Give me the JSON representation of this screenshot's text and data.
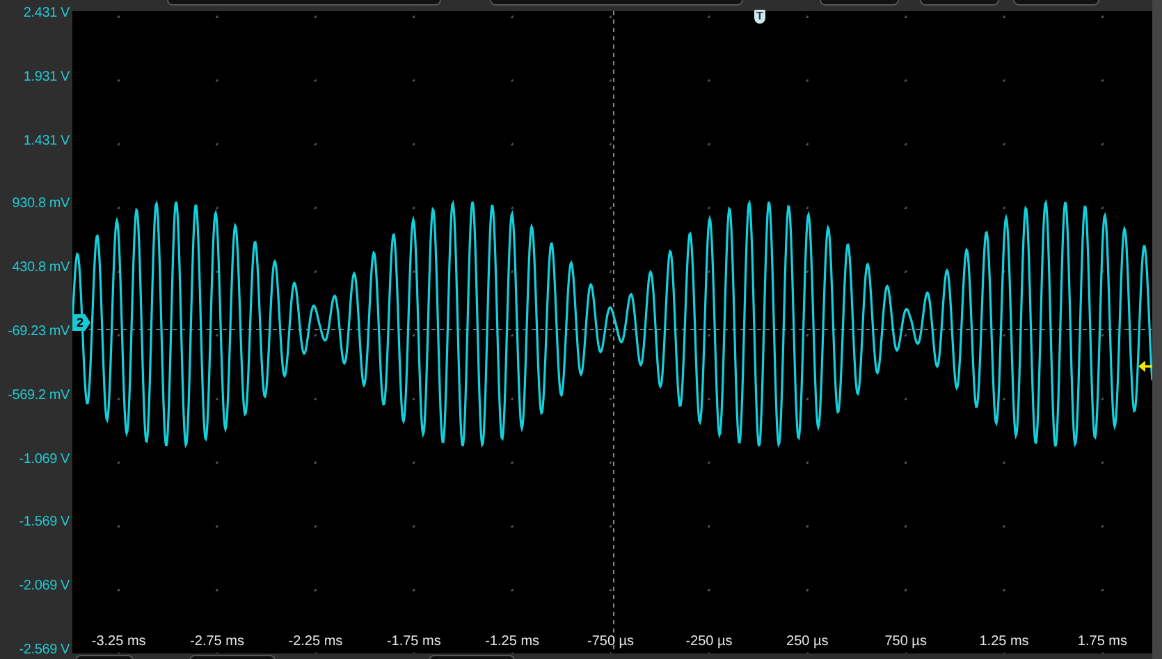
{
  "y_axis": {
    "labels": [
      "2.431 V",
      "1.931 V",
      "1.431 V",
      "930.8 mV",
      "430.8 mV",
      "-69.23 mV",
      "-569.2 mV",
      "-1.069 V",
      "-1.569 V",
      "-2.069 V",
      "-2.569 V"
    ]
  },
  "x_axis": {
    "labels": [
      "-3.25 ms",
      "-2.75 ms",
      "-2.25 ms",
      "-1.75 ms",
      "-1.25 ms",
      "-750 µs",
      "-250 µs",
      "250 µs",
      "750 µs",
      "1.25 ms",
      "1.75 ms"
    ]
  },
  "channel_marker": {
    "label": "2"
  },
  "trigger_marker": {
    "label": "T"
  }
}
